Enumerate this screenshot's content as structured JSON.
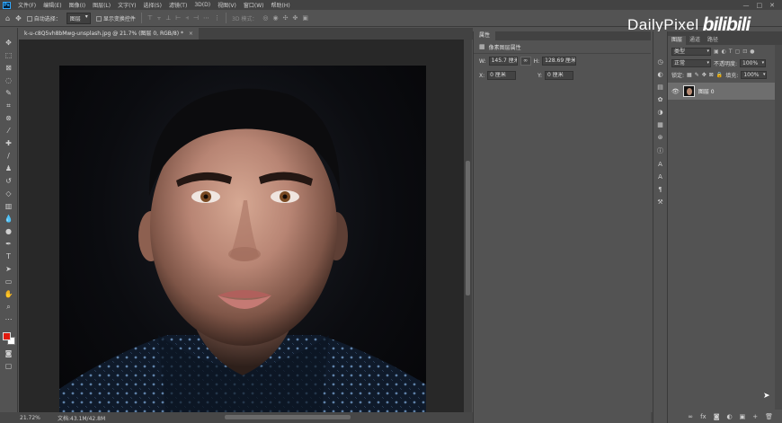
{
  "menubar": {
    "app_icon": "Ps",
    "items": [
      "文件(F)",
      "编辑(E)",
      "图像(I)",
      "图层(L)",
      "文字(Y)",
      "选择(S)",
      "滤镜(T)",
      "3D(D)",
      "视图(V)",
      "窗口(W)",
      "帮助(H)"
    ],
    "window_controls": [
      "—",
      "□",
      "✕"
    ]
  },
  "options": {
    "auto_select_label": "自动选择：",
    "auto_select_target": "图层",
    "show_transform_label": "显示变换控件",
    "mode_3d": "3D 模式："
  },
  "watermark": {
    "text": "DailyPixel",
    "logo": "bilibili"
  },
  "document": {
    "tab_title": "k-u-c8Q5vh8bMwg-unsplash.jpg @ 21.7% (图层 0, RGB/8) *",
    "close": "×"
  },
  "status": {
    "zoom": "21.72%",
    "doc_info": "文档:43.1M/42.8M"
  },
  "properties": {
    "tab": "属性",
    "subhead": "像素图层属性",
    "w_label": "W:",
    "w_value": "145.7 厘米",
    "h_label": "H:",
    "h_value": "128.69 厘米",
    "x_label": "X:",
    "x_value": "0 厘米",
    "y_label": "Y:",
    "y_value": "0 厘米"
  },
  "layers": {
    "tabs": [
      "图层",
      "通道",
      "路径"
    ],
    "kind_filter": "类型",
    "blend_mode": "正常",
    "opacity_label": "不透明度:",
    "opacity_value": "100%",
    "lock_label": "锁定:",
    "fill_label": "填充:",
    "fill_value": "100%",
    "layer_name": "图层 0",
    "footer_icons": [
      "fx",
      "◙",
      "◐",
      "▣",
      "+",
      "🗑"
    ]
  },
  "colors": {
    "foreground": "#e01a0e",
    "background": "#ffffff",
    "ui_dark": "#535353"
  }
}
